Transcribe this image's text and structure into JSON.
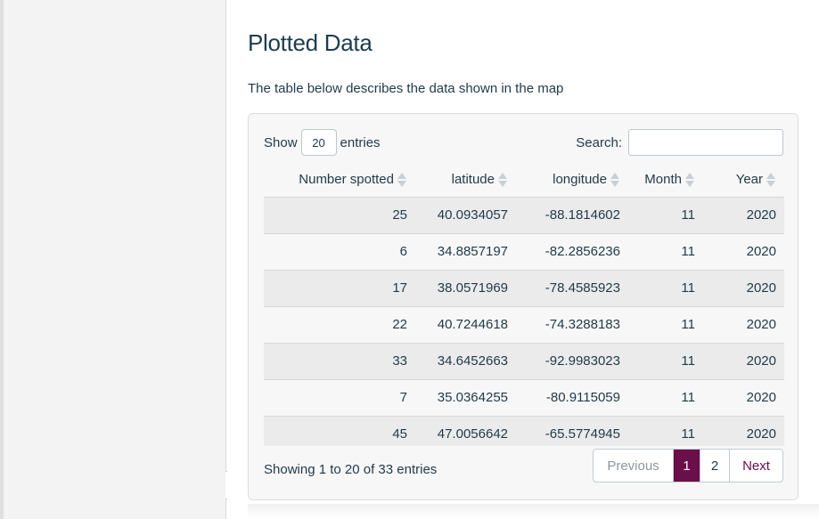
{
  "sidebar": {
    "collapse_icon": "chevron-left-icon",
    "collapse_glyph": "‹"
  },
  "page": {
    "title": "Plotted Data",
    "description": "The table below describes the data shown in the map"
  },
  "table_controls": {
    "show_label": "Show",
    "entries_value": "20",
    "entries_label": "entries",
    "search_label": "Search:",
    "search_value": ""
  },
  "table": {
    "columns": [
      "Number spotted",
      "latitude",
      "longitude",
      "Month",
      "Year"
    ],
    "rows": [
      [
        "25",
        "40.0934057",
        "-88.1814602",
        "11",
        "2020"
      ],
      [
        "6",
        "34.8857197",
        "-82.2856236",
        "11",
        "2020"
      ],
      [
        "17",
        "38.0571969",
        "-78.4585923",
        "11",
        "2020"
      ],
      [
        "22",
        "40.7244618",
        "-74.3288183",
        "11",
        "2020"
      ],
      [
        "33",
        "34.6452663",
        "-92.9983023",
        "11",
        "2020"
      ],
      [
        "7",
        "35.0364255",
        "-80.9115059",
        "11",
        "2020"
      ],
      [
        "45",
        "47.0056642",
        "-65.5774945",
        "11",
        "2020"
      ]
    ]
  },
  "footer": {
    "info": "Showing 1 to 20 of 33 entries",
    "pagination": {
      "previous": "Previous",
      "page1": "1",
      "page2": "2",
      "next": "Next"
    }
  },
  "colors": {
    "accent": "#6a0f4a",
    "text": "#1f3a4a",
    "stripe": "#ebebeb"
  }
}
